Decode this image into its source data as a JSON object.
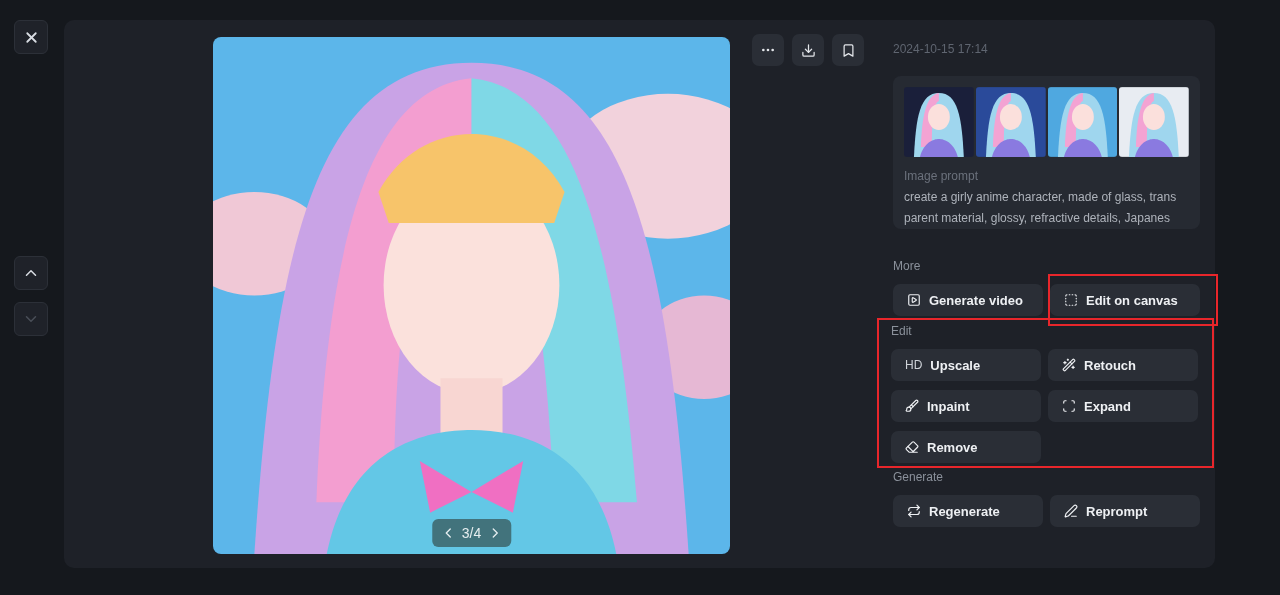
{
  "nav": {
    "up": {
      "disabled": false
    },
    "down": {
      "disabled": true
    }
  },
  "viewer": {
    "pager": "3/4"
  },
  "details": {
    "date": "2024-10-15 17:14",
    "thumbnails": [
      {
        "kind": "picture"
      },
      {
        "kind": "picture"
      },
      {
        "kind": "picture"
      },
      {
        "kind": "picture"
      }
    ],
    "prompt_label": "Image prompt",
    "prompt_lines": [
      "create a girly anime character, made of glass, trans",
      "parent material, glossy, refractive details, Japanes"
    ]
  },
  "sections": [
    {
      "title": "More",
      "highlighted": false,
      "items": [
        {
          "label": "Generate video",
          "kind": "video",
          "highlighted": false
        },
        {
          "label": "Edit on canvas",
          "kind": "canvas",
          "highlighted": true
        }
      ]
    },
    {
      "title": "Edit",
      "highlighted": true,
      "items": [
        {
          "label": "Upscale",
          "kind": "hd",
          "icon_text": "HD",
          "highlighted": false
        },
        {
          "label": "Retouch",
          "kind": "wand",
          "highlighted": false
        },
        {
          "label": "Inpaint",
          "kind": "brush",
          "highlighted": false
        },
        {
          "label": "Expand",
          "kind": "expand",
          "highlighted": false
        },
        {
          "label": "Remove",
          "kind": "eraser",
          "highlighted": false
        }
      ]
    },
    {
      "title": "Generate",
      "highlighted": false,
      "items": [
        {
          "label": "Regenerate",
          "kind": "repeat",
          "highlighted": false
        },
        {
          "label": "Reprompt",
          "kind": "pen",
          "highlighted": false
        }
      ]
    }
  ]
}
